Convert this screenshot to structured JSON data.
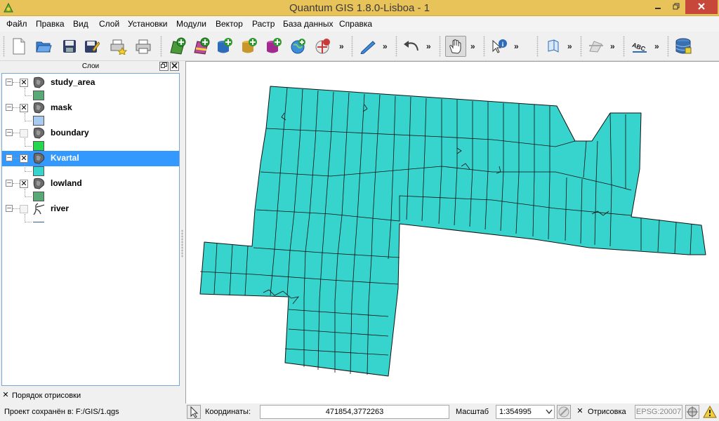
{
  "window": {
    "title": "Quantum GIS 1.8.0-Lisboa - 1"
  },
  "menu": [
    "Файл",
    "Правка",
    "Вид",
    "Слой",
    "Установки",
    "Модули",
    "Вектор",
    "Растр",
    "База данных",
    "Справка"
  ],
  "toolbar": {
    "more": "»"
  },
  "layers_panel": {
    "title": "Слои",
    "layers": [
      {
        "name": "study_area",
        "visible": true,
        "swatch": "#5aa878",
        "type": "polygon"
      },
      {
        "name": "mask",
        "visible": true,
        "swatch": "#a9cbf2",
        "type": "polygon"
      },
      {
        "name": "boundary",
        "visible": false,
        "swatch": "#27d64f",
        "type": "polygon"
      },
      {
        "name": "Kvartal",
        "visible": true,
        "swatch": "#37d3cd",
        "type": "polygon",
        "selected": true
      },
      {
        "name": "lowland",
        "visible": true,
        "swatch": "#5aa878",
        "type": "polygon"
      },
      {
        "name": "river",
        "visible": false,
        "swatch": "#2f5f8f",
        "type": "line"
      }
    ]
  },
  "render_order": {
    "label": "Порядок отрисовки",
    "checked": true
  },
  "statusbar": {
    "message": "Проект сохранён в: F:/GIS/1.qgs",
    "coordinates_label": "Координаты:",
    "coordinates_value": "471854,3772263",
    "scale_label": "Масштаб",
    "scale_value": "1:354995",
    "render_label": "Отрисовка",
    "render_checked": true,
    "crs": "EPSG:20007"
  },
  "colors": {
    "map_fill": "#37d3cd",
    "titlebar": "#e8c35a",
    "selection": "#3399ff"
  }
}
